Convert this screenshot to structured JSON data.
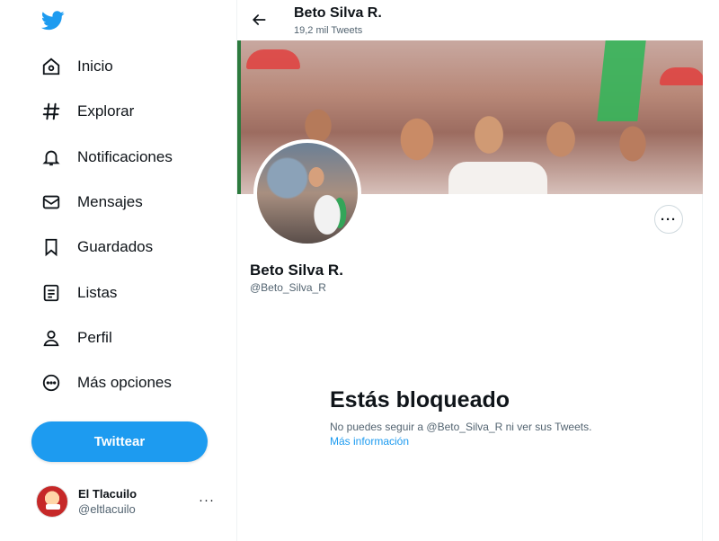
{
  "sidebar": {
    "logo": "twitter-bird-icon",
    "items": [
      {
        "label": "Inicio",
        "icon": "home-icon"
      },
      {
        "label": "Explorar",
        "icon": "hashtag-icon"
      },
      {
        "label": "Notificaciones",
        "icon": "bell-icon"
      },
      {
        "label": "Mensajes",
        "icon": "envelope-icon"
      },
      {
        "label": "Guardados",
        "icon": "bookmark-icon"
      },
      {
        "label": "Listas",
        "icon": "list-icon"
      },
      {
        "label": "Perfil",
        "icon": "person-icon"
      },
      {
        "label": "Más opciones",
        "icon": "more-circle-icon"
      }
    ],
    "tweet_button": "Twittear",
    "account": {
      "name": "El Tlacuilo",
      "handle": "@eltlacuilo",
      "more": "···"
    }
  },
  "header": {
    "title": "Beto Silva R.",
    "tweet_count": "19,2 mil Tweets"
  },
  "profile": {
    "name": "Beto Silva R.",
    "handle": "@Beto_Silva_R",
    "more": "···"
  },
  "blocked": {
    "headline": "Estás bloqueado",
    "message": "No puedes seguir a @Beto_Silva_R ni ver sus Tweets.",
    "link": "Más información"
  },
  "colors": {
    "accent": "#1d9bf0",
    "text": "#0f1419",
    "secondary_text": "#536471"
  }
}
